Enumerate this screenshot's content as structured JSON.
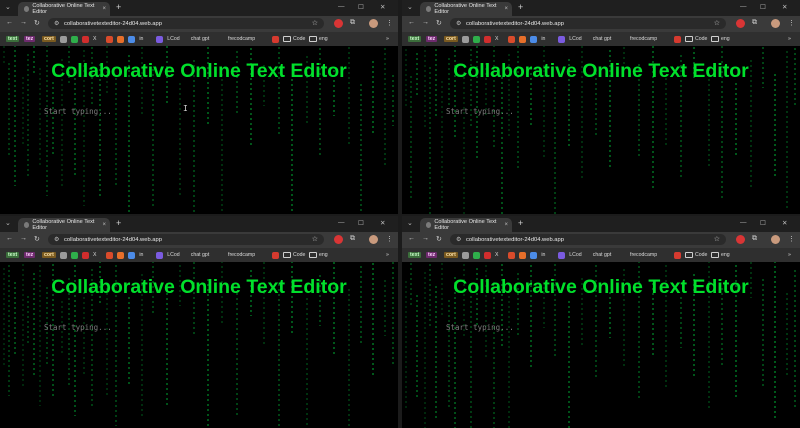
{
  "browser": {
    "tab_title": "Collaborative Online Text Editor",
    "tab_close": "×",
    "new_tab": "+",
    "url": "collaborativetexteditor-24d04.web.app",
    "window_controls": {
      "minimize": "—",
      "maximize": "☐",
      "close": "✕"
    },
    "nav": {
      "back": "←",
      "forward": "→",
      "reload": "↻"
    },
    "star": "☆",
    "bookmarks": [
      {
        "label": "text",
        "bg": "#3b6e3b",
        "fg": "#c8ffc8",
        "type": "chip"
      },
      {
        "label": "tez",
        "bg": "#6e2b6e",
        "fg": "#ffd0ff",
        "type": "chip"
      },
      {
        "label": "cort",
        "bg": "#7a5a20",
        "fg": "#ffe3a8",
        "type": "chip"
      },
      {
        "label": "",
        "bg": "#9b9b9b",
        "type": "dot"
      },
      {
        "label": "",
        "bg": "#2fae4b",
        "type": "dot"
      },
      {
        "label": "",
        "bg": "#d12d2d",
        "type": "dot"
      },
      {
        "label": "X",
        "type": "text"
      },
      {
        "label": "",
        "bg": "#d94b2b",
        "type": "dot"
      },
      {
        "label": "",
        "bg": "#e76f2a",
        "type": "dot"
      },
      {
        "label": "",
        "bg": "#4c8ce8",
        "type": "dot"
      },
      {
        "label": "in",
        "type": "text"
      },
      {
        "label": "",
        "bg": "#7b5be0",
        "type": "dot"
      },
      {
        "label": "LCod",
        "type": "text"
      },
      {
        "label": "chat gpt",
        "type": "text"
      },
      {
        "label": "frecodcamp",
        "type": "text"
      },
      {
        "label": "",
        "bg": "#d63a2f",
        "type": "dot"
      },
      {
        "label": "Code",
        "type": "folder"
      },
      {
        "label": "eng",
        "type": "folder"
      },
      {
        "label": "»",
        "type": "more"
      }
    ]
  },
  "page": {
    "title": "Collaborative Online Text Editor",
    "editor_placeholder": "Start typing...",
    "cursor": "I"
  },
  "colors": {
    "title": "#00e02b",
    "rain": "#00c83c",
    "background": "#000000"
  }
}
